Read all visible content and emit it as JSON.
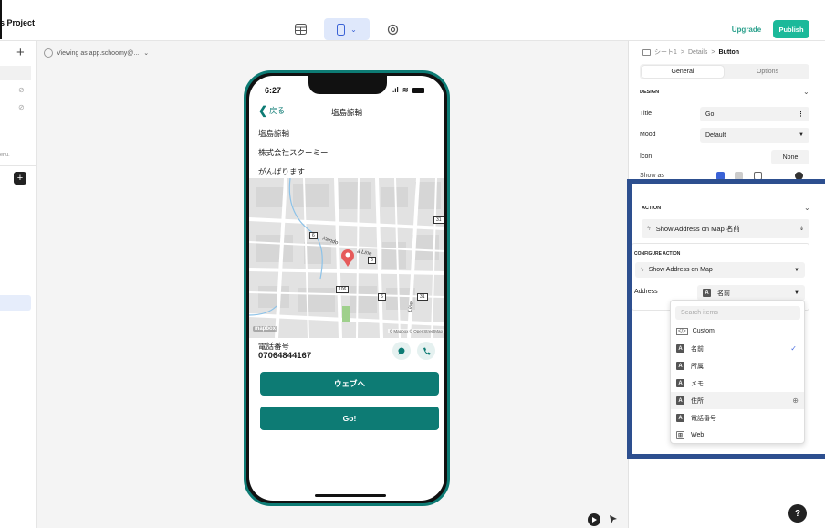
{
  "topbar": {
    "project": "s Project",
    "upgrade": "Upgrade",
    "publish": "Publish"
  },
  "canvas": {
    "viewing": "Viewing as app.schoomy@...",
    "viewing_caret": "⌄"
  },
  "left": {
    "add": "+",
    "menu_text": "enu."
  },
  "phone": {
    "time": "6:27",
    "back": "戻る",
    "title": "塩島諒輔",
    "line1": "塩島諒輔",
    "line2": "株式会社スクーミー",
    "line3": "がんばります",
    "map": {
      "street": "Kendo",
      "street2": "a Line",
      "line_label": "Line",
      "logo": "mapbox",
      "attribution": "© Mapbox © OpenStreetMap",
      "shield_a": "6",
      "shield_b": "6",
      "shield_c": "31",
      "shield_d": "106",
      "shield_e": "6",
      "shield_f": "31"
    },
    "phone_label": "電話番号",
    "phone_value": "07064844167",
    "web_button": "ウェブへ",
    "go_button": "Go!"
  },
  "right": {
    "breadcrumb": {
      "sheet": "シート1",
      "details": "Details",
      "button": "Button",
      "sep": ">"
    },
    "tabs": {
      "general": "General",
      "options": "Options"
    },
    "design_header": "DESIGN",
    "title_label": "Title",
    "title_value": "Go!",
    "mood_label": "Mood",
    "mood_value": "Default",
    "icon_label": "Icon",
    "icon_value": "None",
    "show_as_label": "Show as",
    "action_header": "ACTION",
    "action_value": "Show Address on Map 名前",
    "configure_header": "CONFIGURE ACTION",
    "configure_value": "Show Address on Map",
    "address_label": "Address",
    "address_value": "名前",
    "search_placeholder": "Search items",
    "items": [
      {
        "badge": "</>",
        "label": "Custom"
      },
      {
        "badge": "A",
        "label": "名前"
      },
      {
        "badge": "A",
        "label": "所属"
      },
      {
        "badge": "A",
        "label": "メモ"
      },
      {
        "badge": "A",
        "label": "住所"
      },
      {
        "badge": "A",
        "label": "電話番号"
      },
      {
        "badge": "⊞",
        "label": "Web"
      }
    ],
    "help": "?"
  },
  "colors": {
    "teal": "#0d7b74",
    "publish": "#1bb99a",
    "highlight": "#2d4f8f",
    "check": "#4a6ee0"
  }
}
